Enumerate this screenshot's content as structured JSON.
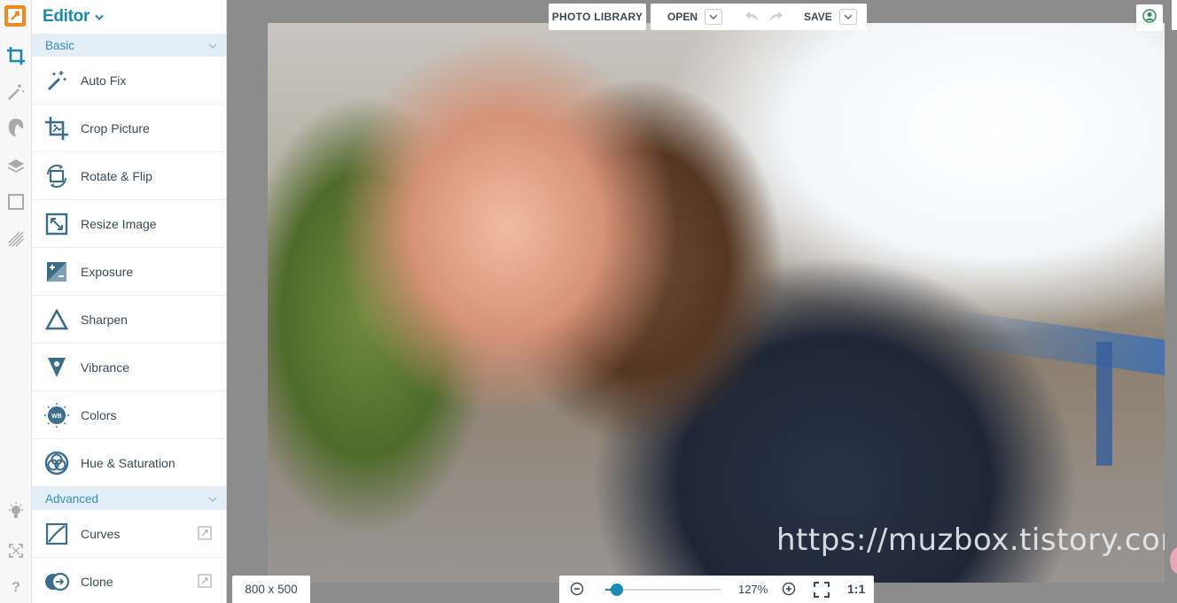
{
  "colors": {
    "accent": "#1a8ab5",
    "icon": "#3c6e8a",
    "section_bg": "#e4eef6",
    "logo": "#f08a1c"
  },
  "panel": {
    "title": "Editor",
    "sections": [
      {
        "label": "Basic",
        "tools": [
          {
            "label": "Auto Fix",
            "icon": "magic-wand-icon"
          },
          {
            "label": "Crop Picture",
            "icon": "crop-icon"
          },
          {
            "label": "Rotate & Flip",
            "icon": "rotate-icon"
          },
          {
            "label": "Resize Image",
            "icon": "resize-icon"
          },
          {
            "label": "Exposure",
            "icon": "exposure-icon"
          },
          {
            "label": "Sharpen",
            "icon": "sharpen-icon"
          },
          {
            "label": "Vibrance",
            "icon": "vibrance-icon"
          },
          {
            "label": "Colors",
            "icon": "colors-icon",
            "badge": "WB"
          },
          {
            "label": "Hue & Saturation",
            "icon": "hue-icon"
          }
        ]
      },
      {
        "label": "Advanced",
        "tools": [
          {
            "label": "Curves",
            "icon": "curves-icon",
            "locked": true
          },
          {
            "label": "Clone",
            "icon": "clone-icon",
            "locked": true
          }
        ]
      }
    ]
  },
  "toolbar": {
    "photo_library": "PHOTO LIBRARY",
    "open": "OPEN",
    "save": "SAVE"
  },
  "canvas": {
    "watermark": "https://muzbox.tistory.com"
  },
  "status": {
    "dimensions": "800 x 500",
    "zoom_percent": "127%",
    "zoom_level": 0.1,
    "actual_size": "1:1"
  }
}
